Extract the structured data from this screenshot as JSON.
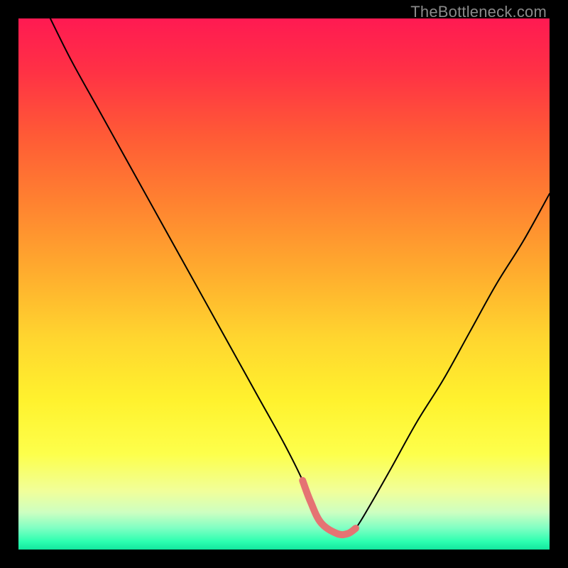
{
  "watermark": "TheBottleneck.com",
  "colors": {
    "frame": "#000000",
    "curve_main": "#000000",
    "curve_accent": "#e57373",
    "gradient_stops": [
      {
        "offset": 0.0,
        "color": "#ff1a52"
      },
      {
        "offset": 0.1,
        "color": "#ff3145"
      },
      {
        "offset": 0.22,
        "color": "#ff5a36"
      },
      {
        "offset": 0.35,
        "color": "#ff8330"
      },
      {
        "offset": 0.48,
        "color": "#ffad2e"
      },
      {
        "offset": 0.6,
        "color": "#ffd52f"
      },
      {
        "offset": 0.72,
        "color": "#fff22e"
      },
      {
        "offset": 0.82,
        "color": "#fdff4b"
      },
      {
        "offset": 0.89,
        "color": "#f1ff9a"
      },
      {
        "offset": 0.93,
        "color": "#cdffc1"
      },
      {
        "offset": 0.96,
        "color": "#7effc3"
      },
      {
        "offset": 0.985,
        "color": "#2cffb0"
      },
      {
        "offset": 1.0,
        "color": "#13e69e"
      }
    ]
  },
  "chart_data": {
    "type": "line",
    "title": "",
    "xlabel": "",
    "ylabel": "",
    "xlim": [
      0,
      100
    ],
    "ylim": [
      0,
      100
    ],
    "series": [
      {
        "name": "bottleneck-curve",
        "x": [
          6,
          10,
          15,
          20,
          25,
          30,
          35,
          40,
          45,
          50,
          53.5,
          55,
          57,
          60,
          62,
          63.5,
          66,
          70,
          75,
          80,
          85,
          90,
          95,
          100
        ],
        "values": [
          100,
          92,
          83,
          74,
          65,
          56,
          47,
          38,
          29,
          20,
          13,
          9,
          5,
          3,
          3,
          4,
          8,
          15,
          24,
          32,
          41,
          50,
          58,
          67
        ]
      }
    ],
    "accent_segment": {
      "name": "valley-accent",
      "x": [
        53.5,
        55,
        57,
        60,
        62,
        63.5
      ],
      "values": [
        13,
        9,
        5,
        3,
        3,
        4
      ]
    }
  }
}
